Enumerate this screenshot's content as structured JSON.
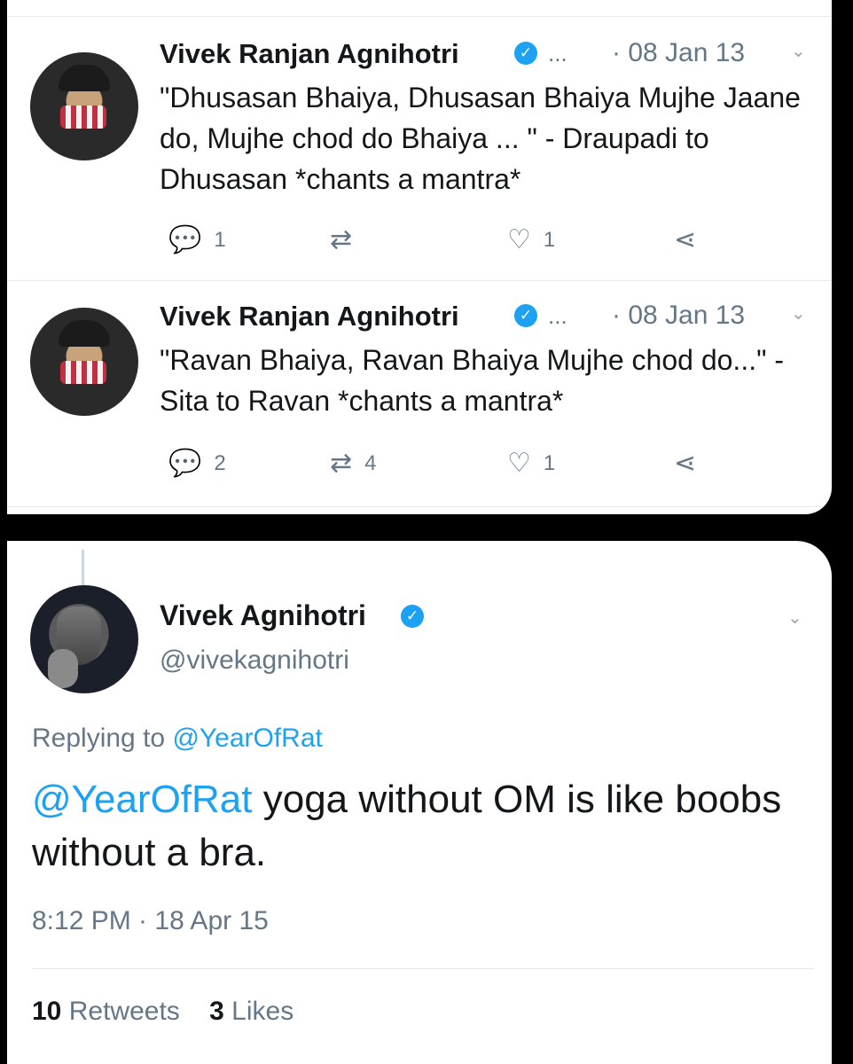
{
  "tweets": [
    {
      "author": "Vivek Ranjan Agnihotri",
      "ellipsis": "...",
      "date": "· 08 Jan 13",
      "text": "\"Dhusasan Bhaiya, Dhusasan Bhaiya Mujhe Jaane do, Mujhe chod do Bhaiya ... \" - Draupadi to Dhusasan *chants a mantra*",
      "reply_count": "1",
      "retweet_count": "",
      "like_count": "1"
    },
    {
      "author": "Vivek Ranjan Agnihotri",
      "ellipsis": "...",
      "date": "· 08 Jan 13",
      "text": "\"Ravan Bhaiya, Ravan Bhaiya Mujhe chod do...\" - Sita to Ravan *chants a mantra*",
      "reply_count": "2",
      "retweet_count": "4",
      "like_count": "1"
    }
  ],
  "main_tweet": {
    "name": "Vivek Agnihotri",
    "handle": "@vivekagnihotri",
    "replying_prefix": "Replying to",
    "replying_to": "@YearOfRat",
    "mention": "@YearOfRat",
    "text": " yoga without OM is like boobs without a bra.",
    "timestamp": "8:12 PM · 18 Apr 15",
    "retweets_count": "10",
    "retweets_label": "Retweets",
    "likes_count": "3",
    "likes_label": "Likes"
  },
  "icons": {
    "verified": "✓",
    "caret": "⌄",
    "reply": "💬",
    "retweet": "⇄",
    "like": "♡",
    "share": "⋖"
  },
  "colors": {
    "accent": "#1da1f2",
    "muted": "#657786",
    "text": "#14171a"
  }
}
